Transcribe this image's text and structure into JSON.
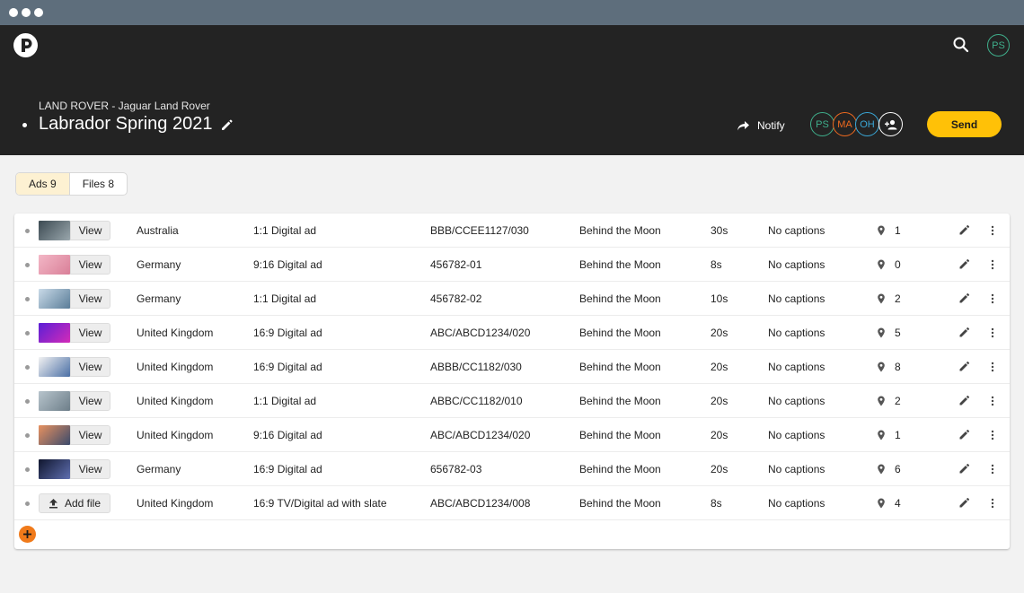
{
  "app": {
    "client": "LAND ROVER - Jaguar Land Rover",
    "title": "Labrador Spring 2021",
    "me_initials": "PS"
  },
  "header": {
    "notify_label": "Notify",
    "send_label": "Send",
    "collaborators": [
      {
        "initials": "PS",
        "color": "#3fae8b"
      },
      {
        "initials": "MA",
        "color": "#f06a1f"
      },
      {
        "initials": "OH",
        "color": "#3aa8d8"
      }
    ]
  },
  "tabs": [
    {
      "label": "Ads 9",
      "active": true
    },
    {
      "label": "Files 8",
      "active": false
    }
  ],
  "ads": [
    {
      "thumb": "aerial-city",
      "action": "View",
      "market": "Australia",
      "format": "1:1 Digital ad",
      "code": "BBB/CCEE1127/030",
      "title": "Behind the Moon",
      "duration": "30s",
      "captions": "No captions",
      "locations": "1"
    },
    {
      "thumb": "pink-portrait",
      "action": "View",
      "market": "Germany",
      "format": "9:16 Digital ad",
      "code": "456782-01",
      "title": "Behind the Moon",
      "duration": "8s",
      "captions": "No captions",
      "locations": "0"
    },
    {
      "thumb": "mountain-lake",
      "action": "View",
      "market": "Germany",
      "format": "1:1 Digital ad",
      "code": "456782-02",
      "title": "Behind the Moon",
      "duration": "10s",
      "captions": "No captions",
      "locations": "2"
    },
    {
      "thumb": "purple-logo",
      "action": "View",
      "market": "United Kingdom",
      "format": "16:9 Digital ad",
      "code": "ABC/ABCD1234/020",
      "title": "Behind the Moon",
      "duration": "20s",
      "captions": "No captions",
      "locations": "5"
    },
    {
      "thumb": "cheering-person",
      "action": "View",
      "market": "United Kingdom",
      "format": "16:9 Digital ad",
      "code": "ABBB/CC1182/030",
      "title": "Behind the Moon",
      "duration": "20s",
      "captions": "No captions",
      "locations": "8"
    },
    {
      "thumb": "misty-figure",
      "action": "View",
      "market": "United Kingdom",
      "format": "1:1 Digital ad",
      "code": "ABBC/CC1182/010",
      "title": "Behind the Moon",
      "duration": "20s",
      "captions": "No captions",
      "locations": "2"
    },
    {
      "thumb": "sunset-sky",
      "action": "View",
      "market": "United Kingdom",
      "format": "9:16 Digital ad",
      "code": "ABC/ABCD1234/020",
      "title": "Behind the Moon",
      "duration": "20s",
      "captions": "No captions",
      "locations": "1"
    },
    {
      "thumb": "night-sky",
      "action": "View",
      "market": "Germany",
      "format": "16:9 Digital ad",
      "code": "656782-03",
      "title": "Behind the Moon",
      "duration": "20s",
      "captions": "No captions",
      "locations": "6"
    },
    {
      "thumb": "",
      "action": "Add file",
      "market": "United Kingdom",
      "format": "16:9 TV/Digital ad with slate",
      "code": "ABC/ABCD1234/008",
      "title": "Behind the Moon",
      "duration": "8s",
      "captions": "No captions",
      "locations": "4"
    }
  ],
  "thumb_colors": {
    "aerial-city": [
      "#3c4a52",
      "#9aa7ad"
    ],
    "pink-portrait": [
      "#f3b7c6",
      "#d97f98"
    ],
    "mountain-lake": [
      "#c9dae8",
      "#5a7d98"
    ],
    "purple-logo": [
      "#5b1fd6",
      "#d42bb8"
    ],
    "cheering-person": [
      "#f2f2f2",
      "#4a6fa5"
    ],
    "misty-figure": [
      "#b7c4cc",
      "#6d7e89"
    ],
    "sunset-sky": [
      "#e79160",
      "#3b4a6b"
    ],
    "night-sky": [
      "#10162e",
      "#5f6fb0"
    ]
  }
}
